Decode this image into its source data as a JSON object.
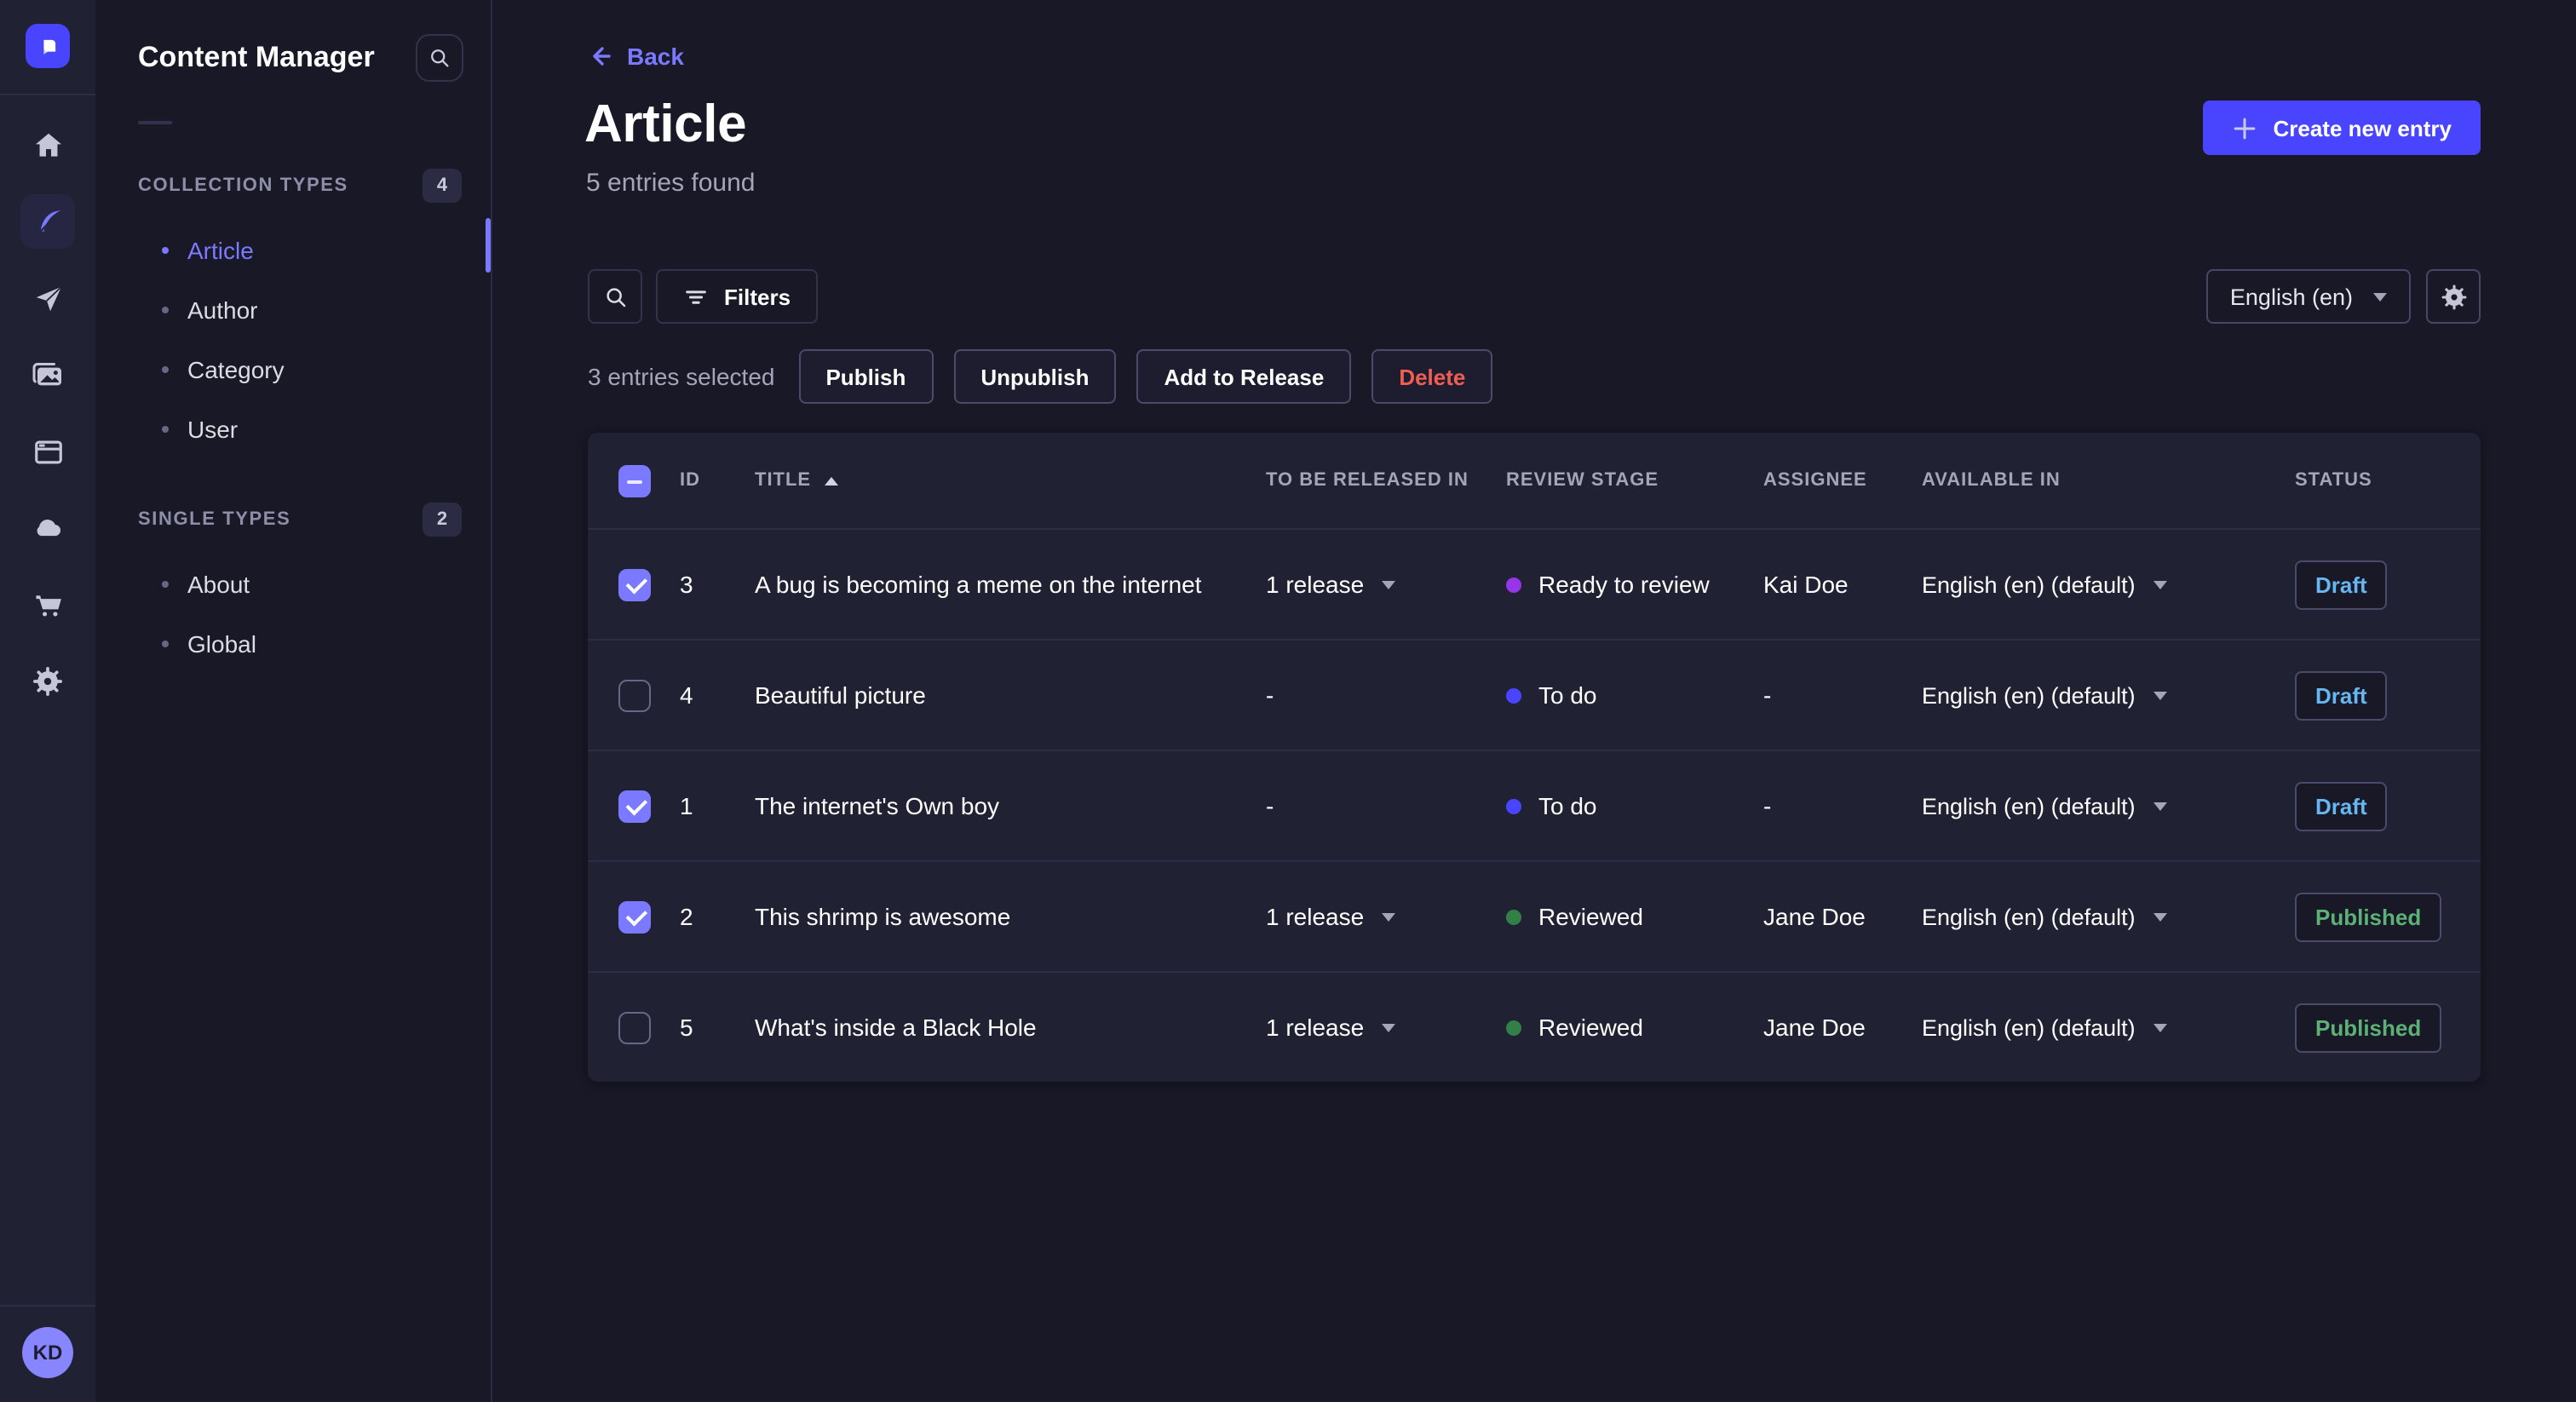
{
  "colors": {
    "accent": "#4945ff",
    "primary_light": "#7b79ff",
    "draft": "#66b7f1",
    "published": "#5cb176",
    "danger": "#ee5e52",
    "stage_todo": "#4945ff",
    "stage_ready_to_review": "#9736e8",
    "stage_reviewed": "#328048"
  },
  "rail": {
    "avatar_initials": "KD",
    "icons": [
      "strapi-logo",
      "home",
      "content-manager-feather",
      "paper-plane",
      "media-library",
      "layout",
      "cloud",
      "marketplace-cart",
      "settings-gear"
    ],
    "active_icon": "content-manager-feather"
  },
  "subnav": {
    "title": "Content Manager",
    "search_icon": "search",
    "sections": [
      {
        "label": "COLLECTION TYPES",
        "count": "4",
        "items": [
          {
            "label": "Article",
            "active": true
          },
          {
            "label": "Author",
            "active": false
          },
          {
            "label": "Category",
            "active": false
          },
          {
            "label": "User",
            "active": false
          }
        ]
      },
      {
        "label": "SINGLE TYPES",
        "count": "2",
        "items": [
          {
            "label": "About",
            "active": false
          },
          {
            "label": "Global",
            "active": false
          }
        ]
      }
    ]
  },
  "header": {
    "back_label": "Back",
    "title": "Article",
    "subtitle": "5 entries found",
    "create_label": "Create new entry"
  },
  "toolbar": {
    "filters_label": "Filters",
    "locale": "English (en)"
  },
  "selection": {
    "text": "3 entries selected",
    "publish_label": "Publish",
    "unpublish_label": "Unpublish",
    "add_to_release_label": "Add to Release",
    "delete_label": "Delete"
  },
  "table": {
    "columns": [
      "ID",
      "TITLE",
      "TO BE RELEASED IN",
      "REVIEW STAGE",
      "ASSIGNEE",
      "AVAILABLE IN",
      "STATUS"
    ],
    "sort": {
      "column": "TITLE",
      "direction": "asc"
    },
    "header_checkbox": "indeterminate",
    "rows": [
      {
        "checked": true,
        "id": "3",
        "title": "A bug is becoming a meme on the internet",
        "release": "1 release",
        "stage": "Ready to review",
        "stage_color": "#9736e8",
        "assignee": "Kai Doe",
        "locale": "English (en) (default)",
        "status": "Draft",
        "status_color": "#66b7f1"
      },
      {
        "checked": false,
        "id": "4",
        "title": "Beautiful picture",
        "release": "-",
        "stage": "To do",
        "stage_color": "#4945ff",
        "assignee": "-",
        "locale": "English (en) (default)",
        "status": "Draft",
        "status_color": "#66b7f1"
      },
      {
        "checked": true,
        "id": "1",
        "title": "The internet's Own boy",
        "release": "-",
        "stage": "To do",
        "stage_color": "#4945ff",
        "assignee": "-",
        "locale": "English (en) (default)",
        "status": "Draft",
        "status_color": "#66b7f1"
      },
      {
        "checked": true,
        "id": "2",
        "title": "This shrimp is awesome",
        "release": "1 release",
        "stage": "Reviewed",
        "stage_color": "#328048",
        "assignee": "Jane Doe",
        "locale": "English (en) (default)",
        "status": "Published",
        "status_color": "#5cb176"
      },
      {
        "checked": false,
        "id": "5",
        "title": "What's inside a Black Hole",
        "release": "1 release",
        "stage": "Reviewed",
        "stage_color": "#328048",
        "assignee": "Jane Doe",
        "locale": "English (en) (default)",
        "status": "Published",
        "status_color": "#5cb176"
      }
    ]
  },
  "help": {
    "icon": "question-mark-circle"
  }
}
